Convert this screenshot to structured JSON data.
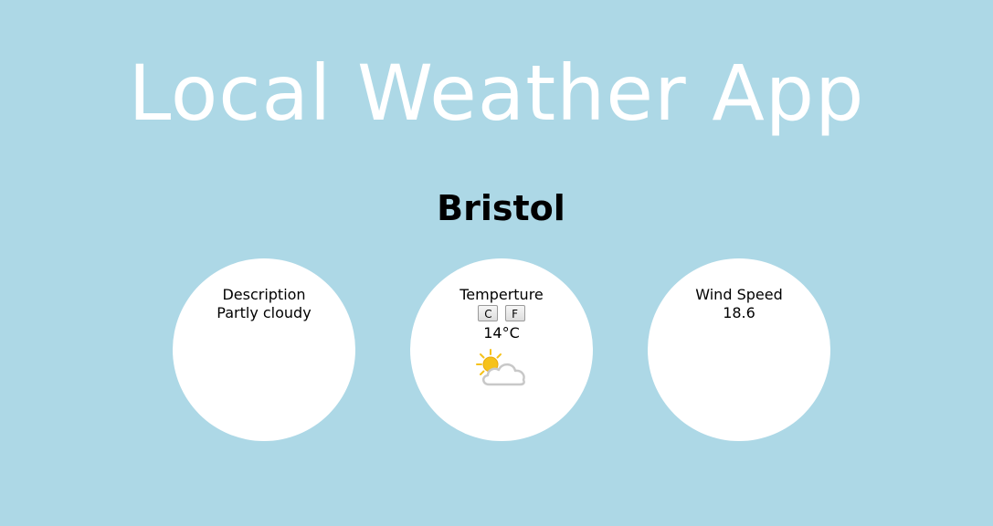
{
  "header": {
    "title": "Local Weather App"
  },
  "location": {
    "city": "Bristol"
  },
  "description": {
    "label": "Description",
    "value": "Partly cloudy"
  },
  "temperature": {
    "label": "Temperture",
    "celsius_button": "C",
    "fahrenheit_button": "F",
    "value": "14°C",
    "icon": "partly-cloudy-icon"
  },
  "wind": {
    "label": "Wind Speed",
    "value": "18.6"
  },
  "colors": {
    "background": "#add8e6",
    "title": "#ffffff",
    "circle": "#ffffff",
    "sun": "#f6c21a"
  }
}
